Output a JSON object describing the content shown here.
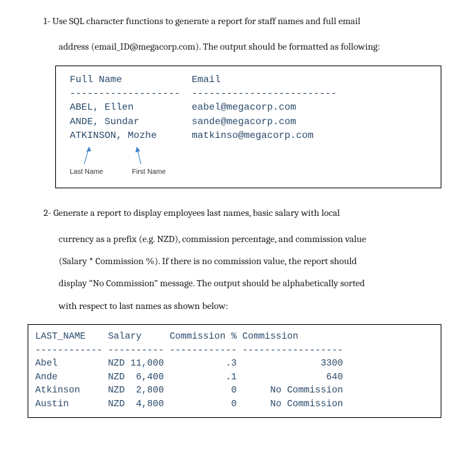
{
  "q1": {
    "num": "1-",
    "text_line1": "1-  Use SQL character functions to generate a report for staff names and full email",
    "text_line2": "address (email_ID@megacorp.com). The output should be formatted as following:",
    "table": {
      "header_full_name": "Full Name",
      "header_email": "Email",
      "dash_left": "-------------------",
      "dash_right": "-------------------------",
      "rows": [
        {
          "name": "ABEL, Ellen",
          "email": "eabel@megacorp.com"
        },
        {
          "name": "ANDE, Sundar",
          "email": "sande@megacorp.com"
        },
        {
          "name": "ATKINSON, Mozhe",
          "email": "matkinso@megacorp.com"
        }
      ]
    },
    "labels": {
      "last_name": "Last Name",
      "first_name": "First Name"
    }
  },
  "q2": {
    "text_line1": "2-  Generate a report to display employees last names, basic salary with local",
    "text_line2": "currency as a prefix (e.g. NZD), commission percentage, and commission value",
    "text_line3": "(Salary * Commission %). If there is no commission value, the report should",
    "text_line4": "display “No Commission” message. The output should be alphabetically sorted",
    "text_line5": "with respect to last names as shown below:",
    "table": {
      "h_last": "LAST_NAME",
      "h_salary": "Salary",
      "h_commpct": "Commission %",
      "h_comm": "Commission",
      "dash1": "------------",
      "dash2": "----------",
      "dash3": "------------",
      "dash4": "------------------",
      "rows": [
        {
          "last": "Abel",
          "salary": "NZD 11,000",
          "pct": ".3",
          "comm": "3300"
        },
        {
          "last": "Ande",
          "salary": "NZD  6,400",
          "pct": ".1",
          "comm": "640"
        },
        {
          "last": "Atkinson",
          "salary": "NZD  2,800",
          "pct": "0",
          "comm": "No Commission"
        },
        {
          "last": "Austin",
          "salary": "NZD  4,800",
          "pct": "0",
          "comm": "No Commission"
        }
      ]
    }
  },
  "chart_data": [
    {
      "type": "table",
      "title": "Staff names and email report",
      "columns": [
        "Full Name",
        "Email"
      ],
      "rows": [
        [
          "ABEL, Ellen",
          "eabel@megacorp.com"
        ],
        [
          "ANDE, Sundar",
          "sande@megacorp.com"
        ],
        [
          "ATKINSON, Mozhe",
          "matkinso@megacorp.com"
        ]
      ],
      "annotations": [
        "Last Name",
        "First Name"
      ]
    },
    {
      "type": "table",
      "title": "Salary and commission report",
      "columns": [
        "LAST_NAME",
        "Salary",
        "Commission %",
        "Commission"
      ],
      "rows": [
        [
          "Abel",
          "NZD 11,000",
          ".3",
          "3300"
        ],
        [
          "Ande",
          "NZD 6,400",
          ".1",
          "640"
        ],
        [
          "Atkinson",
          "NZD 2,800",
          "0",
          "No Commission"
        ],
        [
          "Austin",
          "NZD 4,800",
          "0",
          "No Commission"
        ]
      ]
    }
  ]
}
